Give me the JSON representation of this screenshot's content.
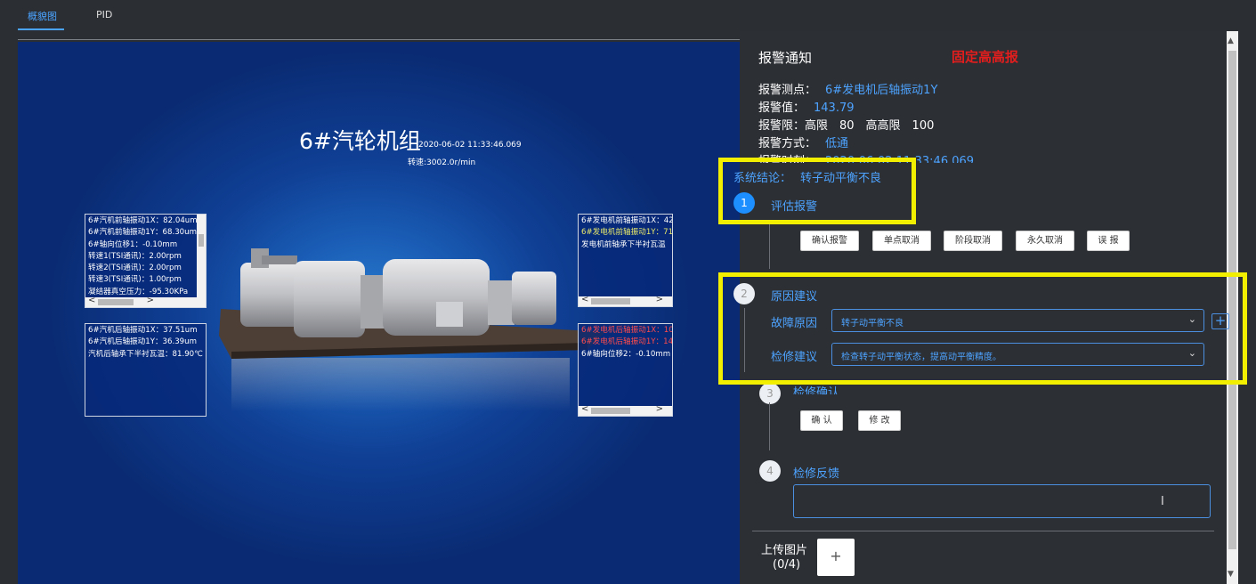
{
  "tabs": [
    {
      "label": "概貌图"
    },
    {
      "label": "PID"
    }
  ],
  "overview": {
    "title": "6#汽轮机组",
    "time": "2020-06-02 11:33:46.069",
    "speed": "转速:3002.0r/min",
    "boxes": [
      {
        "lines": [
          "6#汽机前轴振动1X：82.04um",
          "6#汽机前轴振动1Y：68.30um",
          "6#轴向位移1：-0.10mm",
          "转速1(TSI通讯)：2.00rpm",
          "转速2(TSI通讯)：2.00rpm",
          "转速3(TSI通讯)：1.00rpm",
          "凝结器真空压力：-95.30KPa"
        ]
      },
      {
        "lines": [
          "6#汽机后轴振动1X：37.51um",
          "6#汽机后轴振动1Y：36.39um",
          "汽机后轴承下半衬瓦温：81.90℃"
        ]
      },
      {
        "lines": [
          "6#发电机前轴振动1X：42",
          "6#发电机前轴振动1Y：71",
          "发电机前轴承下半衬瓦温"
        ]
      },
      {
        "lines": [
          "6#发电机后轴振动1X：10",
          "6#发电机后轴振动1Y：14",
          "6#轴向位移2：-0.10mm"
        ]
      }
    ]
  },
  "alarm": {
    "title": "报警通知",
    "type": "固定高高报",
    "point_label": "报警测点：",
    "point_value": "6#发电机后轴振动1Y",
    "value_label": "报警值：",
    "value_value": "143.79",
    "limit_text": "报警限：高限　80　高高限　100",
    "method_label": "报警方式：",
    "method_value": "低通",
    "time_label": "报警时刻：",
    "time_value": "2020-06-02 11:33:46.069"
  },
  "conclusion": {
    "label": "系统结论：",
    "value": "转子动平衡不良"
  },
  "steps": [
    {
      "num": "1",
      "label": "评估报警"
    },
    {
      "num": "2",
      "label": "原因建议"
    },
    {
      "num": "3",
      "label": "检修确认"
    },
    {
      "num": "4",
      "label": "检修反馈"
    }
  ],
  "evaluate_buttons": [
    {
      "label": "确认报警"
    },
    {
      "label": "单点取消"
    },
    {
      "label": "阶段取消"
    },
    {
      "label": "永久取消"
    },
    {
      "label": "误 报"
    }
  ],
  "cause": {
    "fault_label": "故障原因",
    "fault_value": "转子动平衡不良",
    "repair_label": "检修建议",
    "repair_value": "检查转子动平衡状态，提高动平衡精度。"
  },
  "confirm_buttons": [
    {
      "label": "确 认"
    },
    {
      "label": "修 改"
    }
  ],
  "upload": {
    "label": "上传图片",
    "count": "(0/4)",
    "button": "+"
  },
  "highlight_color": "#f2f000",
  "accent_color": "#1e8fff"
}
